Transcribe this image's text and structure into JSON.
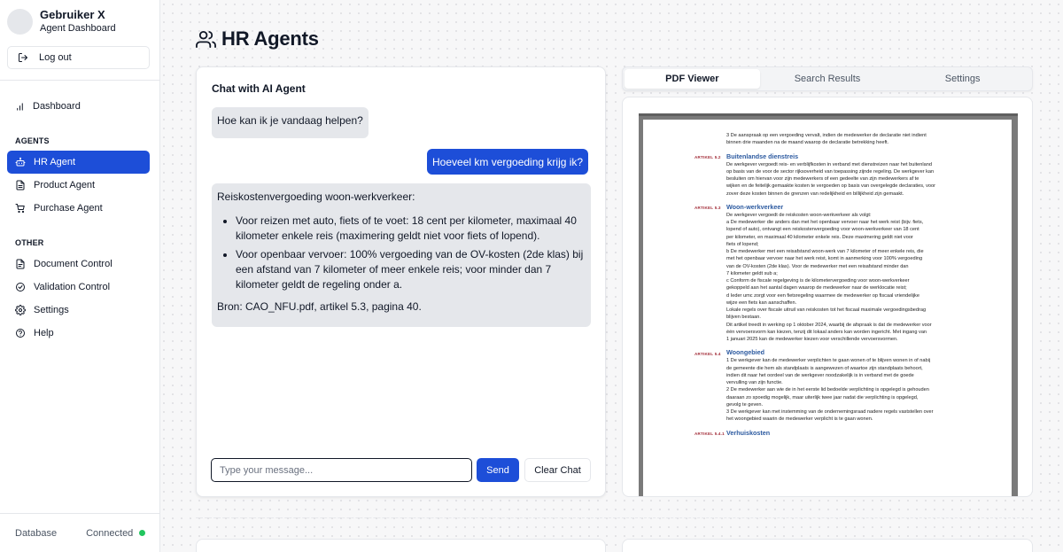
{
  "profile": {
    "name": "Gebruiker X",
    "role": "Agent Dashboard"
  },
  "logout_label": "Log out",
  "nav": {
    "dashboard": "Dashboard",
    "agents_heading": "AGENTS",
    "agents": [
      {
        "label": "HR Agent",
        "icon": "robot-icon",
        "active": true
      },
      {
        "label": "Product Agent",
        "icon": "document-icon"
      },
      {
        "label": "Purchase Agent",
        "icon": "cart-icon"
      }
    ],
    "other_heading": "OTHER",
    "other": [
      {
        "label": "Document Control",
        "icon": "file-icon"
      },
      {
        "label": "Validation Control",
        "icon": "check-circle-icon"
      },
      {
        "label": "Settings",
        "icon": "gear-icon"
      },
      {
        "label": "Help",
        "icon": "help-icon"
      }
    ]
  },
  "status": {
    "label": "Database",
    "value": "Connected",
    "color": "#22c55e"
  },
  "page": {
    "title": "HR Agents"
  },
  "chat": {
    "title": "Chat with AI Agent",
    "messages": [
      {
        "role": "agent",
        "text": "Hoe kan ik je vandaag helpen?"
      },
      {
        "role": "user",
        "text": "Hoeveel km vergoeding krijg ik?"
      },
      {
        "role": "agent",
        "intro": "Reiskostenvergoeding woon-werkverkeer:",
        "bullets": [
          "Voor reizen met auto, fiets of te voet: 18 cent per kilometer, maximaal 40 kilometer enkele reis (maximering geldt niet voor fiets of lopend).",
          "Voor openbaar vervoer: 100% vergoeding van de OV-kosten (2de klas) bij een afstand van 7 kilometer of meer enkele reis; voor minder dan 7 kilometer geldt de regeling onder a."
        ],
        "source": "Bron: CAO_NFU.pdf, artikel 5.3, pagina 40."
      }
    ],
    "input_placeholder": "Type your message...",
    "send_label": "Send",
    "clear_label": "Clear Chat"
  },
  "tabs": [
    {
      "label": "PDF Viewer",
      "active": true
    },
    {
      "label": "Search Results",
      "active": false
    },
    {
      "label": "Settings",
      "active": false
    }
  ],
  "pdf": {
    "intro": [
      "3    De aanspraak op een vergoeding vervalt, indien de medewerker de declaratie niet indient",
      "      binnen drie maanden na de maand waarop de declaratie betrekking heeft."
    ],
    "sections": [
      {
        "tag": "ARTIKEL 5.2",
        "heading": "Buitenlandse dienstreis",
        "lines": [
          "De werkgever vergoedt reis- en verblijfkosten in verband met dienstreizen naar het buitenland",
          "op basis van de voor de sector rijksoverheid van toepassing zijnde regeling. De werkgever kan",
          "besluiten om hiervan voor zijn medewerkers of een gedeelte van zijn medewerkers af te",
          "wijken en de feitelijk gemaakte kosten te vergoeden op basis van overgelegde declaraties, voor",
          "zover deze kosten binnen de grenzen van redelijkheid en billijkheid zijn gemaakt."
        ]
      },
      {
        "tag": "ARTIKEL 5.3",
        "heading": "Woon-werkverkeer",
        "lines": [
          "De werkgever vergoedt de reiskosten woon-werkverkeer als volgt:",
          "a    De medewerker die anders dan met het openbaar vervoer naar het werk reist (bijv. fiets,",
          "      lopend of auto), ontvangt een reiskostenvergoeding voor woon-werkverkeer van 18 cent",
          "      per kilometer, en maximaal 40 kilometer enkele reis. Deze maximering geldt niet voor",
          "      fiets of lopend;",
          "b    De medewerker met een reisafstand woon-werk van 7 kilometer of meer enkele reis, die",
          "      met het openbaar vervoer naar het werk reist, komt in aanmerking voor 100% vergoeding",
          "      van de OV-kosten (2de klas). Voor de medewerker met een reisafstand minder dan",
          "      7 kilometer geldt sub a;",
          "c    Conform de fiscale regelgeving is de kilometervergoeding voor woon-werkverkeer",
          "      gekoppeld aan het aantal dagen waarop de medewerker naar de werklocatie reist;",
          "d    Ieder umc zorgt voor een fietsregeling waarmee de medewerker op fiscaal vriendelijke",
          "      wijze een fiets kan aanschaffen.",
          "Lokale regels over fiscale uitruil van reiskosten tot het fiscaal maximale vergoedingsbedrag",
          "blijven bestaan.",
          "Dit artikel treedt in werking op 1 oktober 2024, waarbij de afspraak is dat de medewerker voor",
          "één vervoersvorm kan kiezen, tenzij dit lokaal anders kan worden ingericht. Met ingang van",
          "1 januari 2025 kan de medewerker kiezen voor verschillende vervoersvormen."
        ]
      },
      {
        "tag": "ARTIKEL 5.4",
        "heading": "Woongebied",
        "lines": [
          "1    De werkgever kan de medewerker verplichten te gaan wonen of te blijven wonen in of nabij",
          "      de gemeente die hem als standplaats is aangewezen of waartoe zijn standplaats behoort,",
          "      indien dit naar het oordeel van de werkgever noodzakelijk is in verband met de goede",
          "      vervulling van zijn functie.",
          "2    De medewerker aan wie de in het eerste lid bedoelde verplichting is opgelegd is gehouden",
          "      daaraan zo spoedig mogelijk, maar uiterlijk twee jaar nadat die verplichting is opgelegd,",
          "      gevolg te geven.",
          "3    De werkgever kan met instemming van de ondernemingsraad nadere regels vaststellen over",
          "      het woongebied waarin de medewerker verplicht is te gaan wonen."
        ]
      },
      {
        "tag": "ARTIKEL 5.4.1",
        "heading": "Verhuiskosten",
        "lines": []
      }
    ]
  }
}
